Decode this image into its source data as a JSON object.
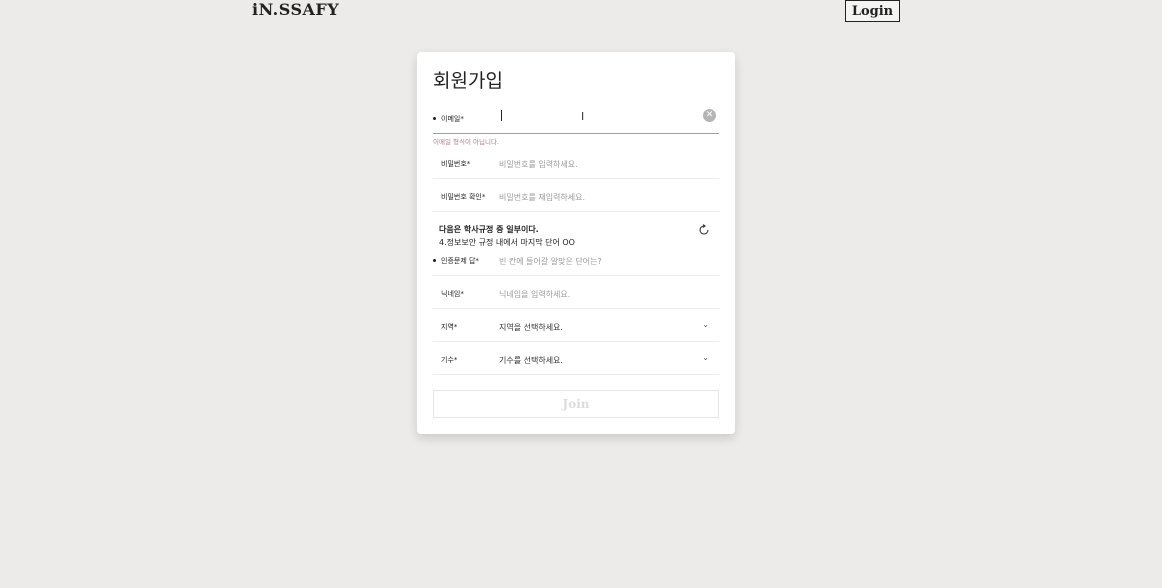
{
  "header": {
    "logo": "iN.SSAFY",
    "login_label": "Login"
  },
  "form": {
    "title": "회원가입",
    "email": {
      "label": "이메일*",
      "value": "",
      "error": "이메일 형식이 아닙니다."
    },
    "password": {
      "label": "비밀번호*",
      "placeholder": "비밀번호를 입력하세요."
    },
    "password_confirm": {
      "label": "비밀번호 확인*",
      "placeholder": "비밀번호를 재입력하세요."
    },
    "quiz": {
      "title": "다음은 학사규정 중 일부이다.",
      "question": "4.정보보안 규정 내에서 마지막 단어 OO",
      "label": "인증문제 답*",
      "placeholder": "빈 칸에 들어갈 알맞은 단어는?"
    },
    "nickname": {
      "label": "닉네임*",
      "placeholder": "닉네임을 입력하세요."
    },
    "region": {
      "label": "지역*",
      "selected": "지역을 선택하세요."
    },
    "generation": {
      "label": "기수*",
      "selected": "기수를 선택하세요."
    },
    "join_label": "Join"
  },
  "icons": {
    "clear": "clear-icon",
    "refresh": "refresh-icon",
    "chevron": "chevron-down-icon"
  }
}
